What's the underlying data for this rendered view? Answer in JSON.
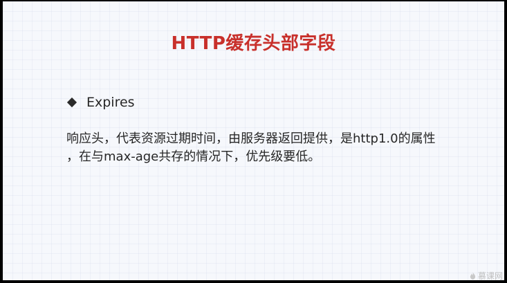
{
  "slide": {
    "title": "HTTP缓存头部字段",
    "bullet": {
      "icon": "diamond-bullet-icon",
      "label": "Expires"
    },
    "description_lines": [
      "响应头，代表资源过期时间，由服务器返回提供，是http1.0的属性",
      "，在与max-age共存的情况下，优先级要低。"
    ]
  },
  "watermark": {
    "icon": "flame-icon",
    "text": "慕课网"
  },
  "colors": {
    "title": "#c8302b",
    "text": "#262626",
    "background": "#f6f8fc"
  }
}
